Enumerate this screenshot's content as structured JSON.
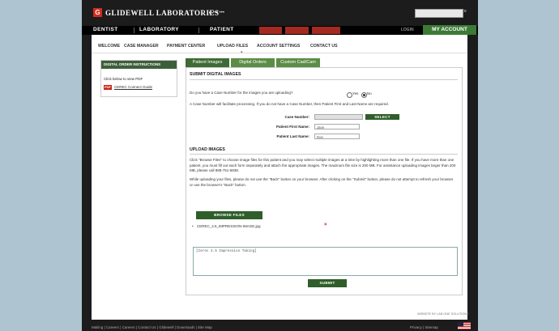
{
  "header": {
    "logo_letter": "G",
    "brand": "GLIDEWELL LABORATORIES",
    "brand_sub": "▸ ••• •••",
    "search_close": "×",
    "nav": [
      "DENTIST",
      "LABORATORY",
      "PATIENT"
    ],
    "login": "LOGIN",
    "account_tab": "MY ACCOUNT"
  },
  "subnav": [
    "WELCOME",
    "CASE MANAGER",
    "PAYMENT CENTER",
    "UPLOAD FILES",
    "ACCOUNT SETTINGS",
    "CONTACT US"
  ],
  "left_panel": {
    "title": "DIGITAL ORDER INSTRUCTIONS",
    "text": "Click below to view PDF",
    "pdf_badge": "PDF",
    "link": "CEREC Connect Guide"
  },
  "tabs": [
    "Patient Images",
    "Digital Orders",
    "Custom Cad/Cam"
  ],
  "form": {
    "title": "SUBMIT DIGITAL IMAGES",
    "question": "Do you have a Case Number for the images you are uploading?",
    "yes": "Yes",
    "no": "No",
    "note": "A Case Number will facilitate processing. If you do not have a Case Number, then Patient First and Last Name are required.",
    "case_number_label": "Case Number:",
    "case_number_value": "",
    "select_button": "SELECT",
    "first_name_label": "Patient First Name:",
    "first_name_value": "Jane",
    "last_name_label": "Patient Last Name:",
    "last_name_value": "Doe"
  },
  "upload": {
    "title": "UPLOAD IMAGES",
    "instructions_1": "Click \"Browse Files\" to choose image files for this patient and you may select multiple images at a time by highlighting more than one file. If you have more than one patient, you must fill out each form separately and attach the appropriate images. The maximum file size is 200 MB. For assistance uploading images larger than 200 MB, please call 888-751-5838.",
    "instructions_2": "While uploading your files, please do not use the \"Back\" button on your browser. After clicking on the \"Submit\" button, please do not attempt to refresh your browser or use the browser's \"Back\" button.",
    "browse_button": "BROWSE FILES",
    "file_bullet": "•",
    "file_name": "CEREC_4.5_IMPRESSION-IMAGE.jpg",
    "remove": "×",
    "notes_value": "[Cerec 4.5 Impression Taking]",
    "submit_button": "SUBMIT"
  },
  "footer": {
    "links": "Mailing | Careers | Careers | Contact Us | Glidewell | Downloads | Site Map",
    "right": "Privacy | Sitemap",
    "powered": "WEBSITE BY LAB ONE SOLUTIONS"
  }
}
